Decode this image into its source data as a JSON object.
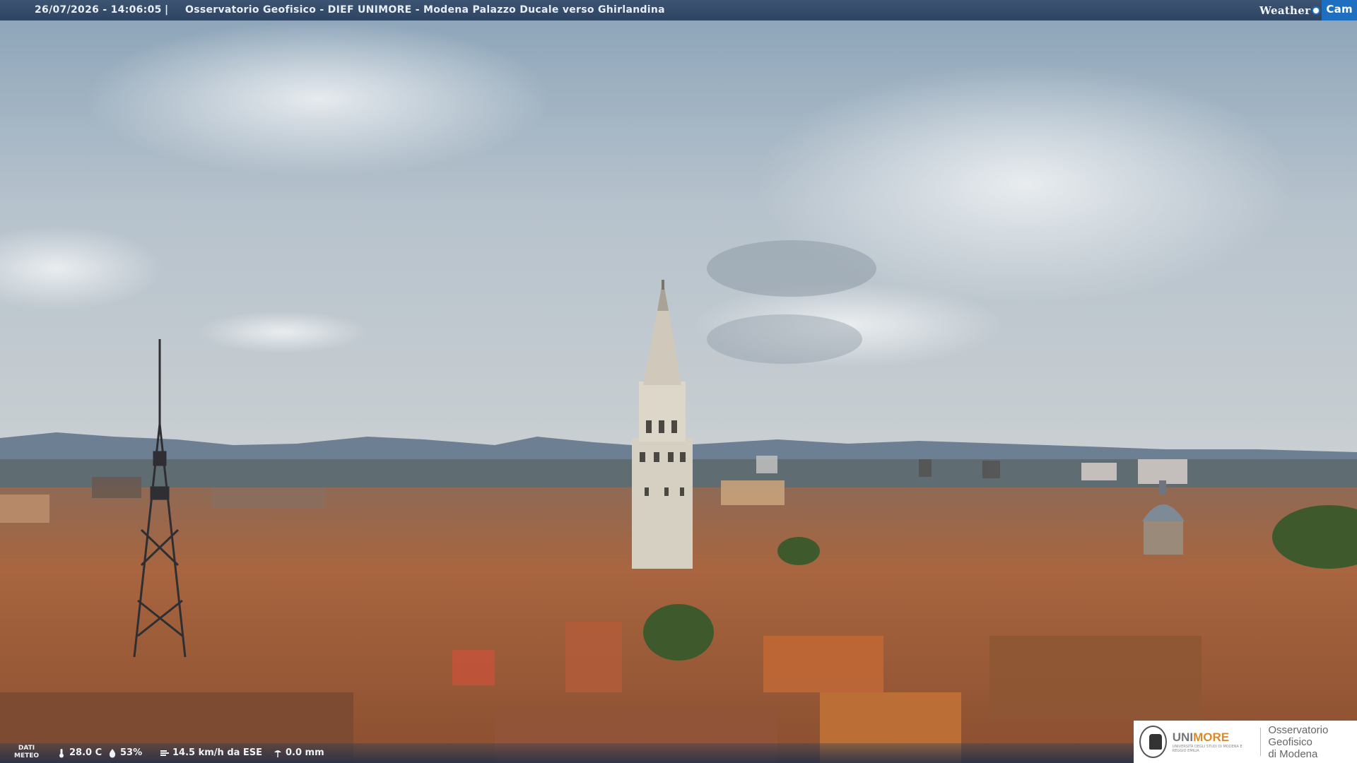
{
  "header": {
    "timestamp": "26/07/2026 - 14:06:05",
    "separator": "|",
    "title": "Osservatorio Geofisico - DIEF UNIMORE - Modena Palazzo Ducale verso Ghirlandina"
  },
  "brand": {
    "weather": "Weather",
    "cam": "Cam"
  },
  "meteo": {
    "label_line1": "DATI",
    "label_line2": "METEO",
    "temperature": "28.0 C",
    "humidity": "53%",
    "wind": "14.5 km/h da ESE",
    "rain": "0.0 mm"
  },
  "logo": {
    "uni": "UNI",
    "more": "MORE",
    "sub": "UNIVERSITÀ DEGLI STUDI DI MODENA E REGGIO EMILIA",
    "obs_line1": "Osservatorio Geofisico",
    "obs_line2": "di Modena"
  },
  "colors": {
    "sky_top": "#8ea6bc",
    "sky_mid": "#b7c3cc",
    "roofs": "#a8653f",
    "tower": "#d9d3c6",
    "bar": "#2d4562",
    "cam_blue": "#1f6fc0"
  },
  "icons": [
    "thermometer-icon",
    "humidity-drop-icon",
    "wind-icon",
    "rain-icon"
  ]
}
